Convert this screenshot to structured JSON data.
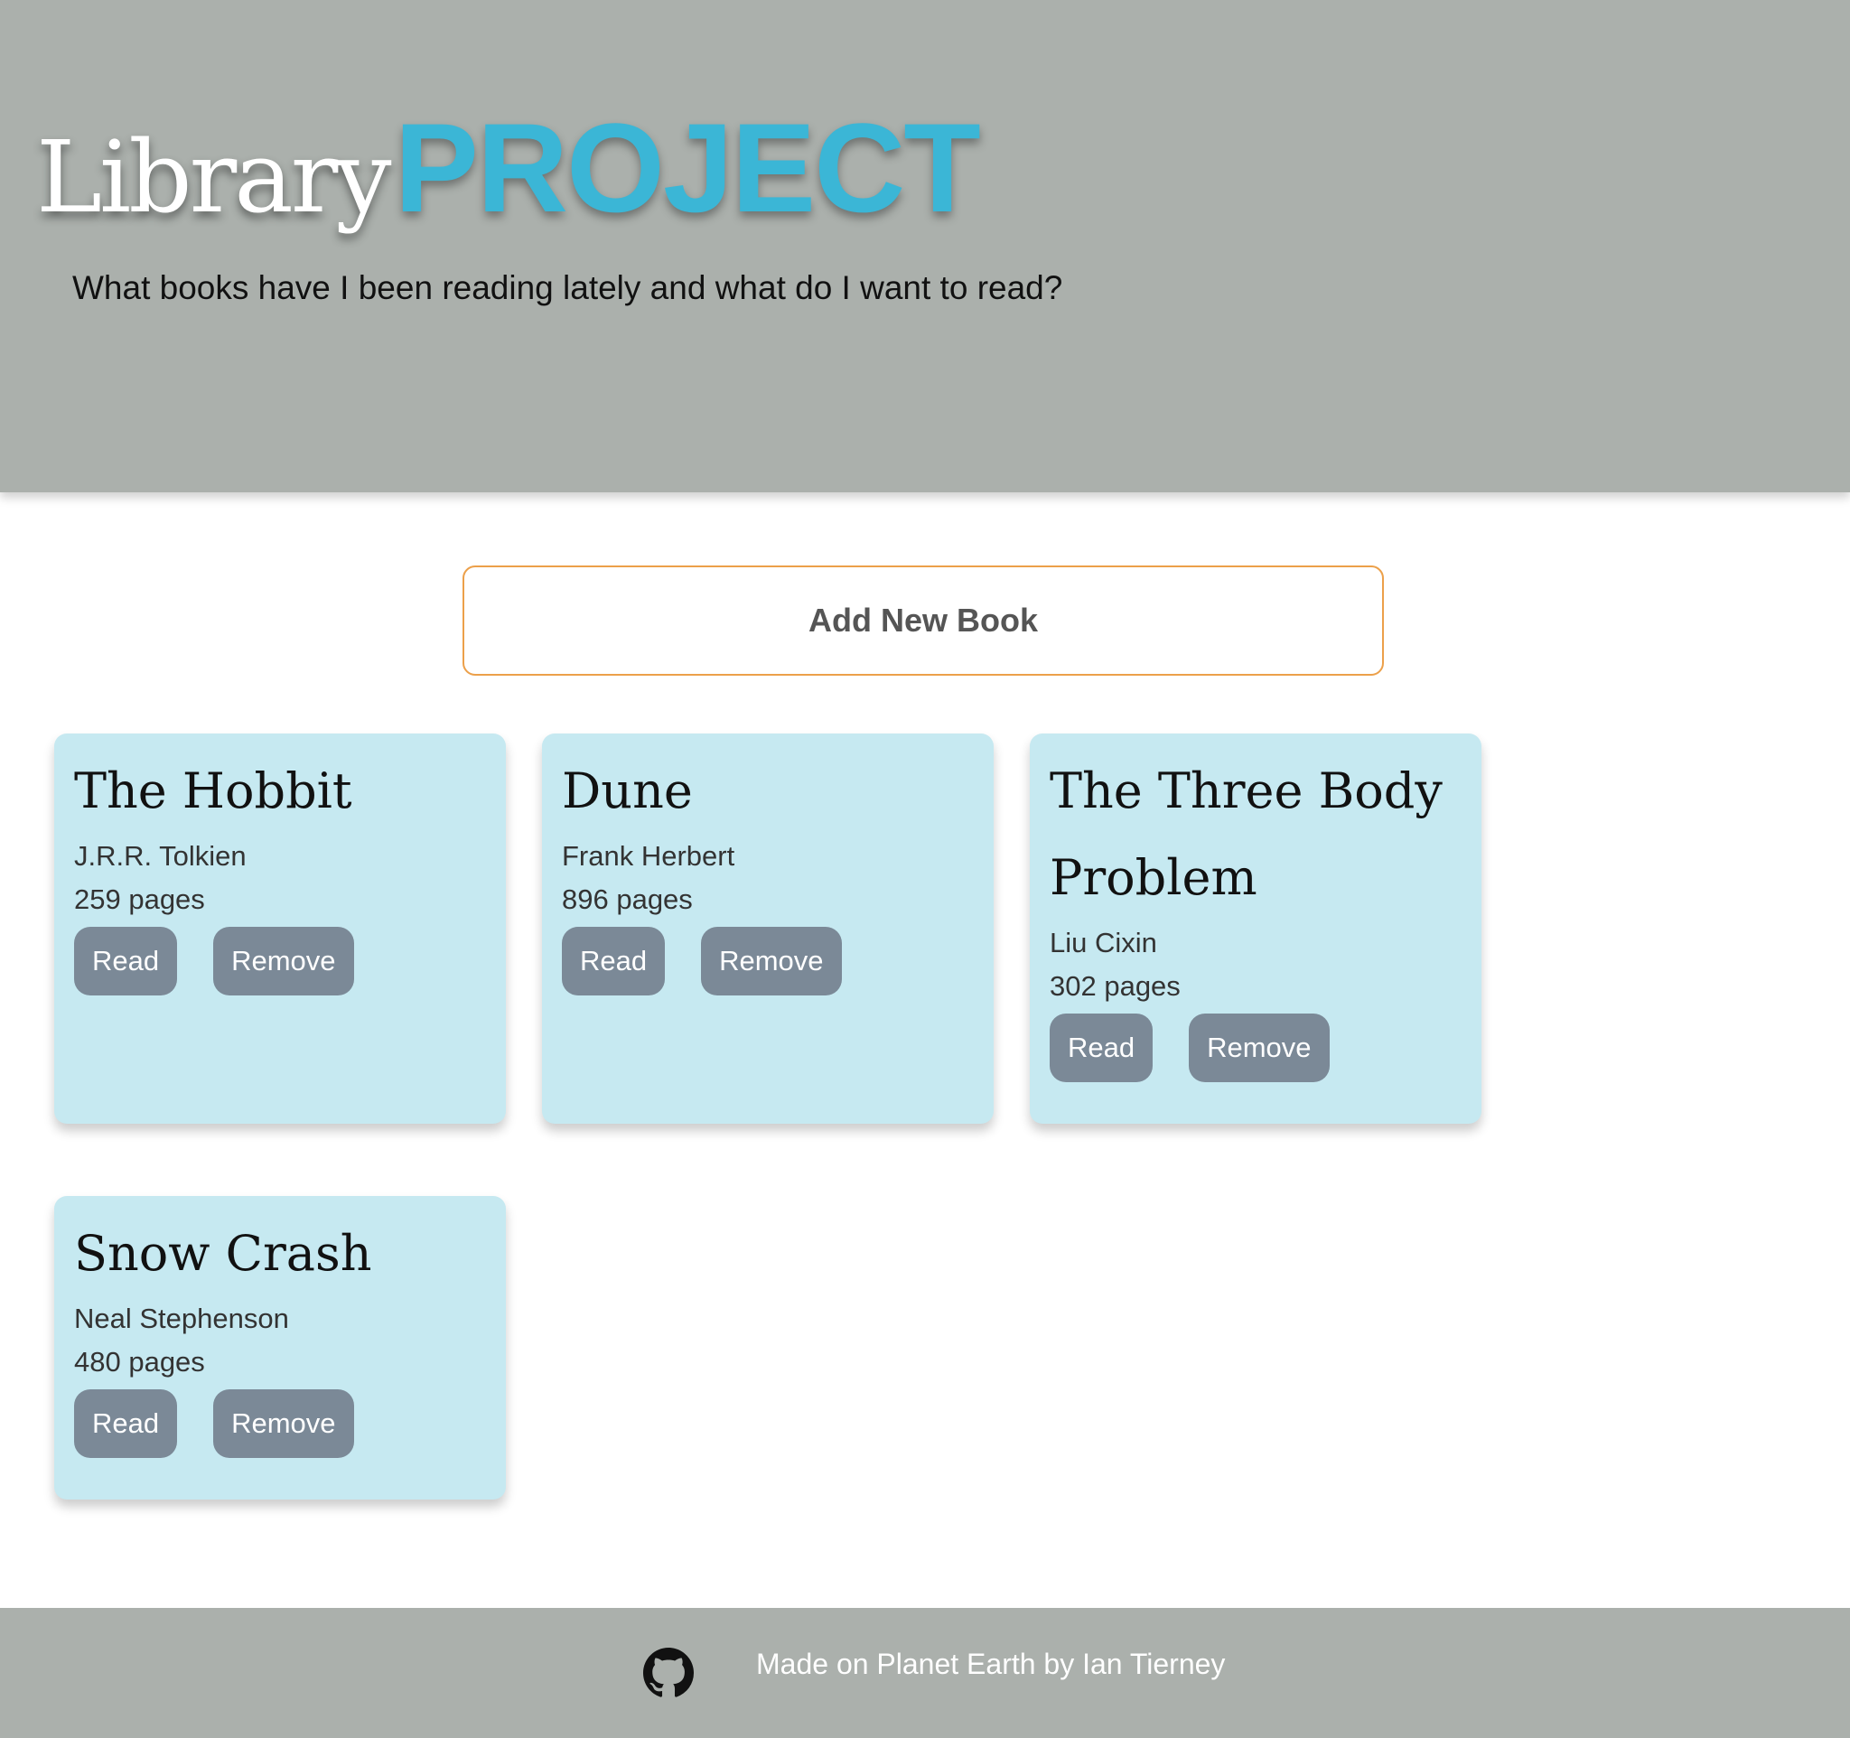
{
  "header": {
    "title_part1": "Library",
    "title_part2": "PROJECT",
    "subtitle": "What books have I been reading lately and what do I want to read?"
  },
  "actions": {
    "add_book_label": "Add New Book"
  },
  "books": [
    {
      "title": "The Hobbit",
      "author": "J.R.R. Tolkien",
      "pages": "259 pages",
      "read_label": "Read",
      "remove_label": "Remove"
    },
    {
      "title": "Dune",
      "author": "Frank Herbert",
      "pages": "896 pages",
      "read_label": "Read",
      "remove_label": "Remove"
    },
    {
      "title": "The Three Body Problem",
      "author": "Liu Cixin",
      "pages": "302 pages",
      "read_label": "Read",
      "remove_label": "Remove"
    },
    {
      "title": "Snow Crash",
      "author": "Neal Stephenson",
      "pages": "480 pages",
      "read_label": "Read",
      "remove_label": "Remove"
    }
  ],
  "footer": {
    "text": "Made on Planet Earth by Ian Tierney",
    "icon": "github-icon"
  },
  "colors": {
    "header_bg": "#abb0ac",
    "accent": "#3bb6d6",
    "card_bg": "#c6e9f1",
    "button_bg": "#7b8997",
    "add_button_border": "#eca04a"
  }
}
